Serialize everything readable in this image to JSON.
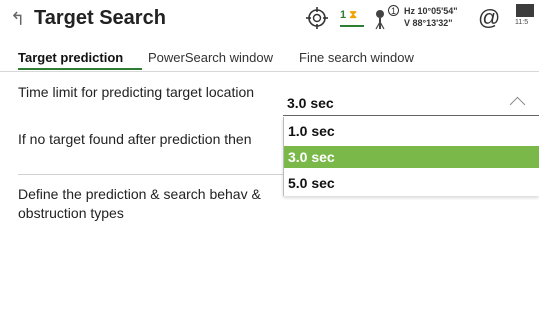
{
  "header": {
    "back_icon": "back-arrow-icon",
    "title": "Target Search",
    "status": {
      "target_icon": "target-crosshair-icon",
      "counter_value": "1",
      "prism_icon": "prism-icon",
      "prism_number": "1",
      "hz_label": "Hz",
      "hz_value": "10°05'54\"",
      "v_label": "V",
      "v_value": "88°13'32\"",
      "at_symbol": "@",
      "battery_icon": "battery-icon",
      "time_partial": "11:5"
    }
  },
  "tabs": [
    {
      "label": "Target prediction",
      "active": true
    },
    {
      "label": "PowerSearch window",
      "active": false
    },
    {
      "label": "Fine search window",
      "active": false
    }
  ],
  "form": {
    "time_limit_label": "Time limit for predicting target location",
    "time_limit_value": "3.0 sec",
    "no_target_label": "If no target found after prediction then",
    "define_text": "Define the prediction & search behav & obstruction types"
  },
  "dropdown": {
    "options": [
      "1.0 sec",
      "3.0 sec",
      "5.0 sec"
    ],
    "selected": "3.0 sec"
  },
  "colors": {
    "accent_green": "#2e7d32",
    "selected_option": "#7bb84a",
    "counter_orange": "#f2a200"
  }
}
